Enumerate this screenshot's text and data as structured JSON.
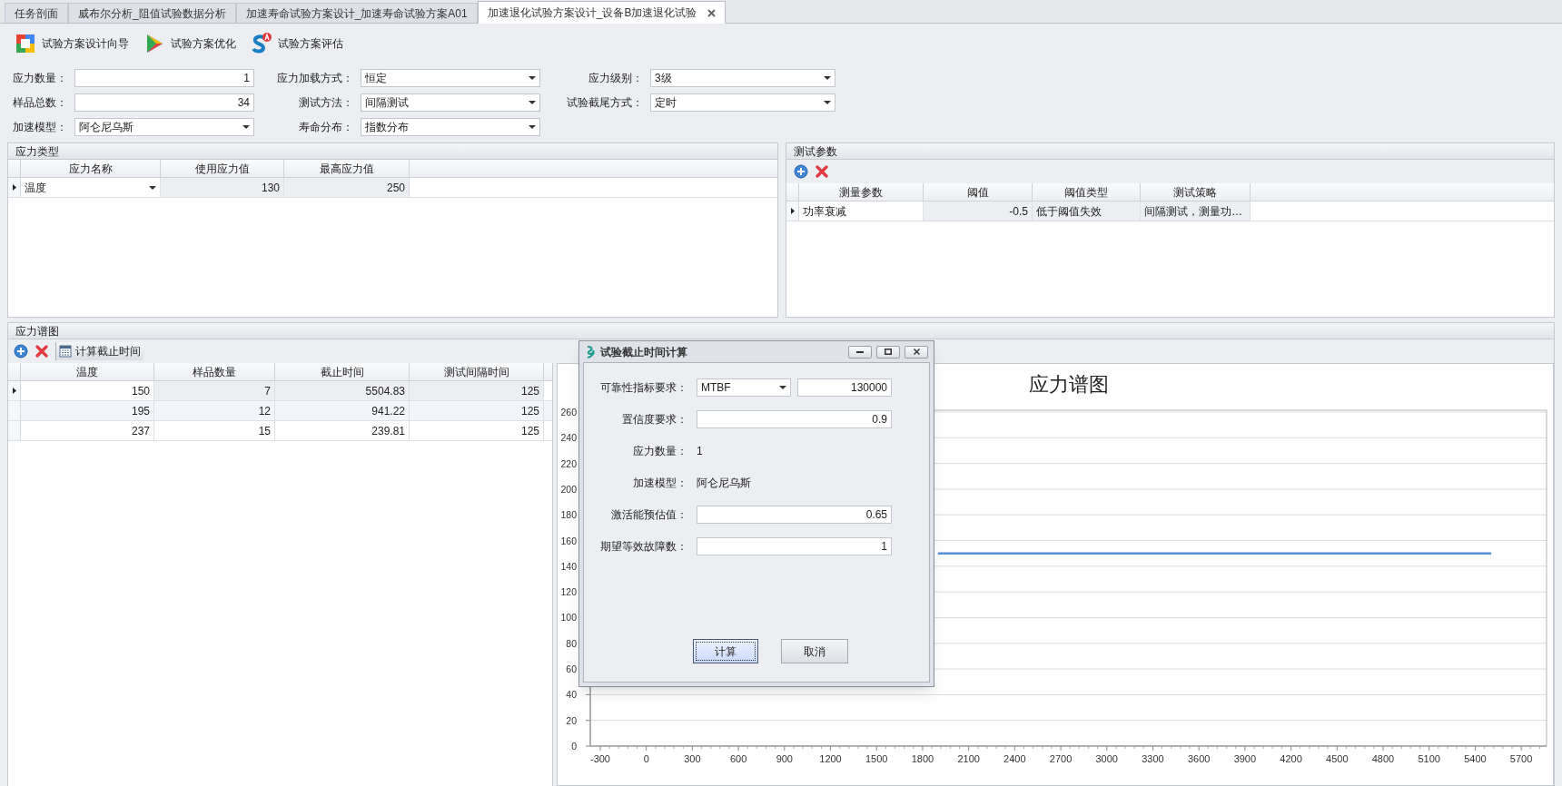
{
  "tabs": [
    {
      "label": "任务剖面",
      "selected": false
    },
    {
      "label": "威布尔分析_阻值试验数据分析",
      "selected": false
    },
    {
      "label": "加速寿命试验方案设计_加速寿命试验方案A01",
      "selected": false
    },
    {
      "label": "加速退化试验方案设计_设备B加速退化试验",
      "selected": true
    }
  ],
  "toolbar": [
    {
      "label": "试验方案设计向导",
      "kind": "wizard"
    },
    {
      "label": "试验方案优化",
      "kind": "optimize"
    },
    {
      "label": "试验方案评估",
      "kind": "evaluate"
    }
  ],
  "form": {
    "fields": [
      {
        "label": "应力数量：",
        "value": "1",
        "kind": "number"
      },
      {
        "label": "应力加载方式：",
        "value": "恒定",
        "kind": "select"
      },
      {
        "label": "应力级别：",
        "value": "3级",
        "kind": "select"
      },
      {
        "label": "样品总数：",
        "value": "34",
        "kind": "number"
      },
      {
        "label": "测试方法：",
        "value": "间隔测试",
        "kind": "select"
      },
      {
        "label": "试验截尾方式：",
        "value": "定时",
        "kind": "select"
      },
      {
        "label": "加速模型：",
        "value": "阿仑尼乌斯",
        "kind": "select"
      },
      {
        "label": "寿命分布：",
        "value": "指数分布",
        "kind": "select"
      }
    ]
  },
  "stress_type": {
    "title": "应力类型",
    "table": {
      "columns": [
        "应力名称",
        "使用应力值",
        "最高应力值"
      ],
      "rows": [
        {
          "selected": true,
          "cells": [
            {
              "text": "温度",
              "kind": "select"
            },
            {
              "text": "130",
              "kind": "number"
            },
            {
              "text": "250",
              "kind": "number"
            }
          ]
        }
      ]
    }
  },
  "test_params": {
    "title": "测试参数",
    "table": {
      "columns": [
        "测量参数",
        "阈值",
        "阈值类型",
        "测试策略"
      ],
      "rows": [
        {
          "selected": true,
          "cells": [
            {
              "text": "功率衰减",
              "kind": "text"
            },
            {
              "text": "-0.5",
              "kind": "number"
            },
            {
              "text": "低于阈值失效",
              "kind": "text"
            },
            {
              "text": "间隔测试，测量功…",
              "kind": "text"
            }
          ]
        }
      ]
    }
  },
  "stress_spectrum": {
    "title": "应力谱图",
    "toolbar_button": "计算截止时间",
    "table": {
      "columns": [
        "温度",
        "样品数量",
        "截止时间",
        "测试间隔时间"
      ],
      "rows": [
        {
          "selected": true,
          "cells": [
            {
              "text": "150",
              "kind": "number"
            },
            {
              "text": "7",
              "kind": "number"
            },
            {
              "text": "5504.83",
              "kind": "number"
            },
            {
              "text": "125",
              "kind": "number"
            }
          ]
        },
        {
          "selected": false,
          "cells": [
            {
              "text": "195",
              "kind": "number"
            },
            {
              "text": "12",
              "kind": "number"
            },
            {
              "text": "941.22",
              "kind": "number"
            },
            {
              "text": "125",
              "kind": "number"
            }
          ]
        },
        {
          "selected": false,
          "cells": [
            {
              "text": "237",
              "kind": "number"
            },
            {
              "text": "15",
              "kind": "number"
            },
            {
              "text": "239.81",
              "kind": "number"
            },
            {
              "text": "125",
              "kind": "number"
            }
          ]
        }
      ]
    },
    "chart_data": {
      "type": "line",
      "title": "应力谱图",
      "grid": true,
      "x": [
        1900,
        5504.83
      ],
      "series": [
        {
          "color": "#5b8fd6",
          "values": [
            150,
            150
          ]
        }
      ],
      "xlim": [
        -365,
        5865
      ],
      "ylim": [
        0,
        260
      ],
      "xticks": [
        -300,
        0,
        300,
        600,
        900,
        1200,
        1500,
        1800,
        2100,
        2400,
        2700,
        3000,
        3300,
        3600,
        3900,
        4200,
        4500,
        4800,
        5100,
        5400,
        5700
      ],
      "yticks": [
        0,
        20,
        40,
        60,
        80,
        100,
        120,
        140,
        160,
        180,
        200,
        220,
        240,
        260
      ]
    }
  },
  "dialog": {
    "title": "试验截止时间计算",
    "rows": [
      {
        "label": "可靠性指标要求：",
        "kind": "select_input",
        "option": "MTBF",
        "value": "130000"
      },
      {
        "label": "置信度要求：",
        "kind": "input",
        "value": "0.9"
      },
      {
        "label": "应力数量：",
        "kind": "text",
        "value": "1"
      },
      {
        "label": "加速模型：",
        "kind": "text",
        "value": "阿仑尼乌斯"
      },
      {
        "label": "激活能预估值：",
        "kind": "input",
        "value": "0.65"
      },
      {
        "label": "期望等效故障数：",
        "kind": "input",
        "value": "1"
      }
    ],
    "buttons": [
      {
        "label": "计算",
        "default": true
      },
      {
        "label": "取消",
        "default": false
      }
    ]
  }
}
